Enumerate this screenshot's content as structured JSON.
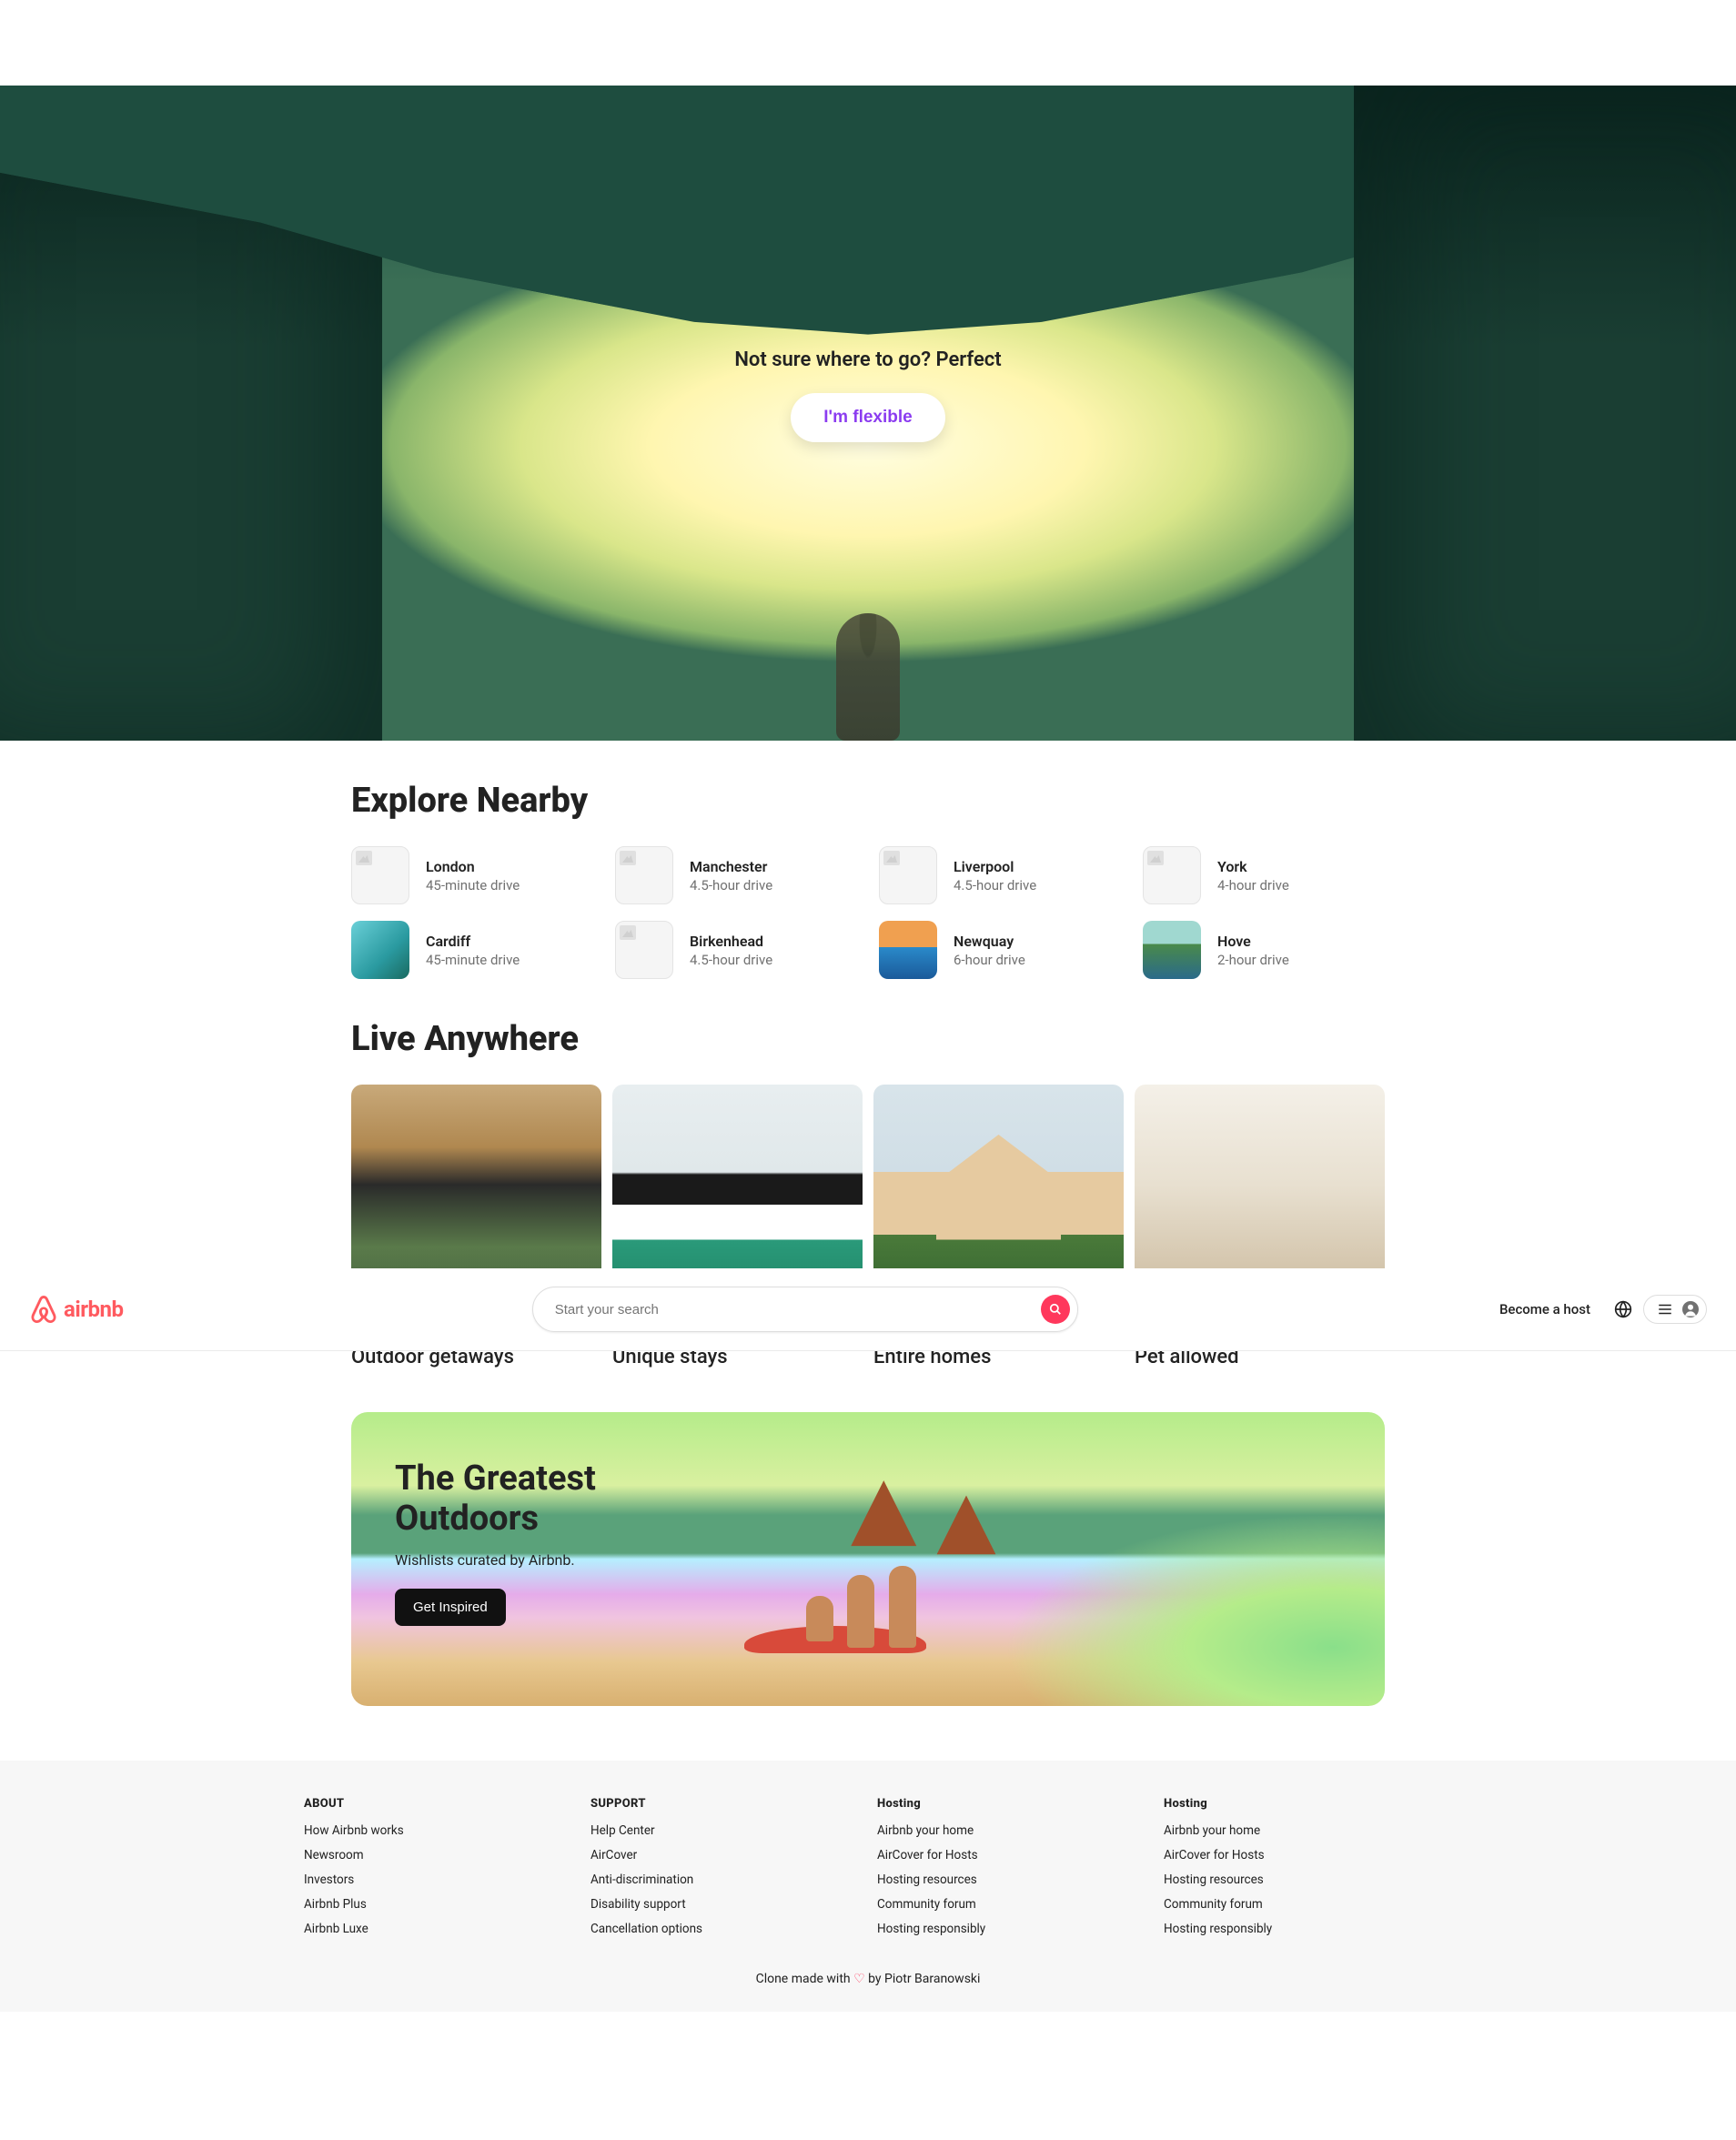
{
  "hero": {
    "tagline": "Not sure where to go? Perfect",
    "button": "I'm flexible"
  },
  "sections": {
    "nearby_title": "Explore Nearby",
    "live_title": "Live Anywhere"
  },
  "nearby": [
    {
      "name": "London",
      "sub": "45-minute drive",
      "colored": false
    },
    {
      "name": "Manchester",
      "sub": "4.5-hour drive",
      "colored": false
    },
    {
      "name": "Liverpool",
      "sub": "4.5-hour drive",
      "colored": false
    },
    {
      "name": "York",
      "sub": "4-hour drive",
      "colored": false
    },
    {
      "name": "Cardiff",
      "sub": "45-minute drive",
      "colored": true,
      "bg": "linear-gradient(135deg,#6ad0d8,#2a9aa0 60%,#1a6a60)"
    },
    {
      "name": "Birkenhead",
      "sub": "4.5-hour drive",
      "colored": false
    },
    {
      "name": "Newquay",
      "sub": "6-hour drive",
      "colored": true,
      "bg": "linear-gradient(180deg,#f0a050 0%,#f0a050 45%,#2a8aca 45%,#1a5a9a)"
    },
    {
      "name": "Hove",
      "sub": "2-hour drive",
      "colored": true,
      "bg": "linear-gradient(180deg,#a0d8d0 0%,#a0d8d0 40%,#4a8a4a 40%,#2a6a8a)"
    }
  ],
  "live": [
    {
      "label": "Outdoor getaways",
      "cls": "outdoor-img"
    },
    {
      "label": "Unique stays",
      "cls": "unique-img"
    },
    {
      "label": "Entire homes",
      "cls": "entire-img"
    },
    {
      "label": "Pet allowed",
      "cls": "pet-img"
    }
  ],
  "banner": {
    "title": "The Greatest Outdoors",
    "sub": "Wishlists curated by Airbnb.",
    "button": "Get Inspired"
  },
  "header": {
    "brand": "airbnb",
    "search_placeholder": "Start your search",
    "host": "Become a host"
  },
  "footer": {
    "cols": [
      {
        "title": "ABOUT",
        "links": [
          "How Airbnb works",
          "Newsroom",
          "Investors",
          "Airbnb Plus",
          "Airbnb Luxe"
        ]
      },
      {
        "title": "SUPPORT",
        "links": [
          "Help Center",
          "AirCover",
          "Anti-discrimination",
          "Disability support",
          "Cancellation options"
        ]
      },
      {
        "title": "Hosting",
        "links": [
          "Airbnb your home",
          "AirCover for Hosts",
          "Hosting resources",
          "Community forum",
          "Hosting responsibly"
        ]
      },
      {
        "title": "Hosting",
        "links": [
          "Airbnb your home",
          "AirCover for Hosts",
          "Hosting resources",
          "Community forum",
          "Hosting responsibly"
        ]
      }
    ],
    "credit_pre": "Clone made with ",
    "credit_post": " by Piotr Baranowski"
  }
}
